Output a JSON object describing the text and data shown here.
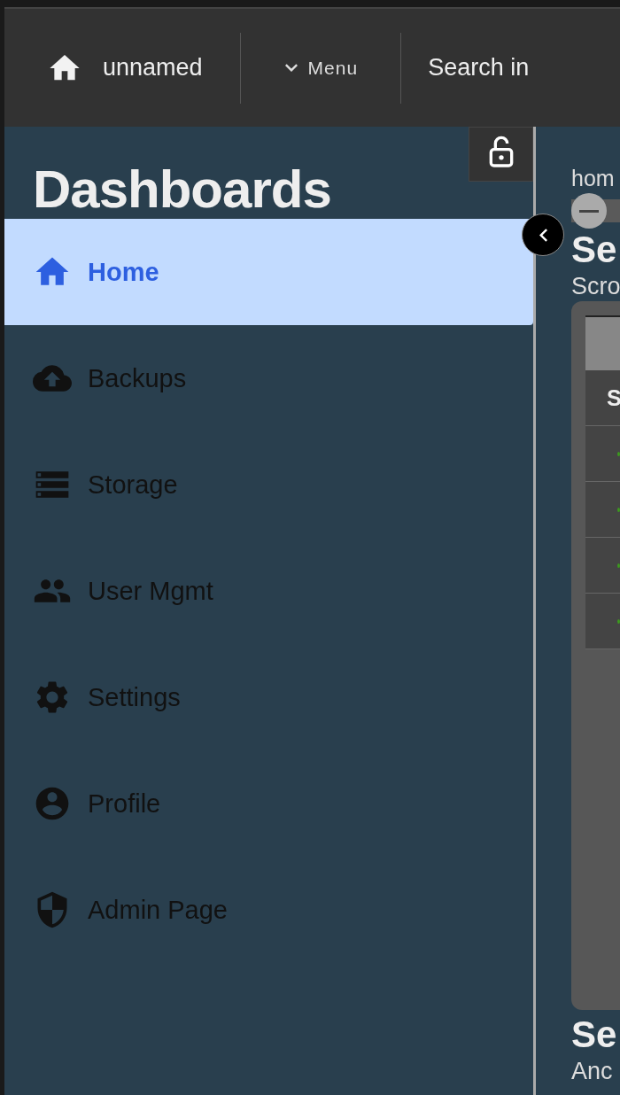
{
  "topbar": {
    "title": "unnamed",
    "menu_label": "Menu",
    "search_label": "Search in"
  },
  "sidebar": {
    "title": "Dashboards",
    "locked": false,
    "items": [
      {
        "label": "Home",
        "selected": true
      },
      {
        "label": "Backups",
        "selected": false
      },
      {
        "label": "Storage",
        "selected": false
      },
      {
        "label": "User Mgmt",
        "selected": false
      },
      {
        "label": "Settings",
        "selected": false
      },
      {
        "label": "Profile",
        "selected": false
      },
      {
        "label": "Admin Page",
        "selected": false
      }
    ]
  },
  "content": {
    "breadcrumb": "hom",
    "sections": [
      {
        "heading": "Se",
        "text": "Scro",
        "table": {
          "rows": [
            {
              "kind": "text",
              "cell": "S"
            },
            {
              "kind": "status"
            },
            {
              "kind": "status"
            },
            {
              "kind": "status"
            },
            {
              "kind": "status"
            }
          ]
        }
      },
      {
        "heading": "Se",
        "text": "Anc"
      }
    ]
  }
}
